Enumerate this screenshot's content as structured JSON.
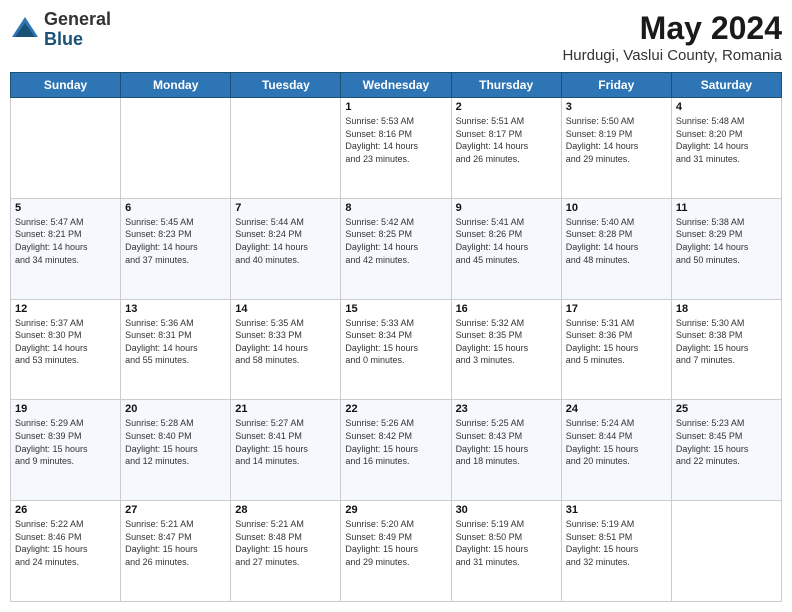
{
  "logo": {
    "general": "General",
    "blue": "Blue"
  },
  "title": "May 2024",
  "subtitle": "Hurdugi, Vaslui County, Romania",
  "weekdays": [
    "Sunday",
    "Monday",
    "Tuesday",
    "Wednesday",
    "Thursday",
    "Friday",
    "Saturday"
  ],
  "weeks": [
    [
      {
        "day": "",
        "info": ""
      },
      {
        "day": "",
        "info": ""
      },
      {
        "day": "",
        "info": ""
      },
      {
        "day": "1",
        "info": "Sunrise: 5:53 AM\nSunset: 8:16 PM\nDaylight: 14 hours\nand 23 minutes."
      },
      {
        "day": "2",
        "info": "Sunrise: 5:51 AM\nSunset: 8:17 PM\nDaylight: 14 hours\nand 26 minutes."
      },
      {
        "day": "3",
        "info": "Sunrise: 5:50 AM\nSunset: 8:19 PM\nDaylight: 14 hours\nand 29 minutes."
      },
      {
        "day": "4",
        "info": "Sunrise: 5:48 AM\nSunset: 8:20 PM\nDaylight: 14 hours\nand 31 minutes."
      }
    ],
    [
      {
        "day": "5",
        "info": "Sunrise: 5:47 AM\nSunset: 8:21 PM\nDaylight: 14 hours\nand 34 minutes."
      },
      {
        "day": "6",
        "info": "Sunrise: 5:45 AM\nSunset: 8:23 PM\nDaylight: 14 hours\nand 37 minutes."
      },
      {
        "day": "7",
        "info": "Sunrise: 5:44 AM\nSunset: 8:24 PM\nDaylight: 14 hours\nand 40 minutes."
      },
      {
        "day": "8",
        "info": "Sunrise: 5:42 AM\nSunset: 8:25 PM\nDaylight: 14 hours\nand 42 minutes."
      },
      {
        "day": "9",
        "info": "Sunrise: 5:41 AM\nSunset: 8:26 PM\nDaylight: 14 hours\nand 45 minutes."
      },
      {
        "day": "10",
        "info": "Sunrise: 5:40 AM\nSunset: 8:28 PM\nDaylight: 14 hours\nand 48 minutes."
      },
      {
        "day": "11",
        "info": "Sunrise: 5:38 AM\nSunset: 8:29 PM\nDaylight: 14 hours\nand 50 minutes."
      }
    ],
    [
      {
        "day": "12",
        "info": "Sunrise: 5:37 AM\nSunset: 8:30 PM\nDaylight: 14 hours\nand 53 minutes."
      },
      {
        "day": "13",
        "info": "Sunrise: 5:36 AM\nSunset: 8:31 PM\nDaylight: 14 hours\nand 55 minutes."
      },
      {
        "day": "14",
        "info": "Sunrise: 5:35 AM\nSunset: 8:33 PM\nDaylight: 14 hours\nand 58 minutes."
      },
      {
        "day": "15",
        "info": "Sunrise: 5:33 AM\nSunset: 8:34 PM\nDaylight: 15 hours\nand 0 minutes."
      },
      {
        "day": "16",
        "info": "Sunrise: 5:32 AM\nSunset: 8:35 PM\nDaylight: 15 hours\nand 3 minutes."
      },
      {
        "day": "17",
        "info": "Sunrise: 5:31 AM\nSunset: 8:36 PM\nDaylight: 15 hours\nand 5 minutes."
      },
      {
        "day": "18",
        "info": "Sunrise: 5:30 AM\nSunset: 8:38 PM\nDaylight: 15 hours\nand 7 minutes."
      }
    ],
    [
      {
        "day": "19",
        "info": "Sunrise: 5:29 AM\nSunset: 8:39 PM\nDaylight: 15 hours\nand 9 minutes."
      },
      {
        "day": "20",
        "info": "Sunrise: 5:28 AM\nSunset: 8:40 PM\nDaylight: 15 hours\nand 12 minutes."
      },
      {
        "day": "21",
        "info": "Sunrise: 5:27 AM\nSunset: 8:41 PM\nDaylight: 15 hours\nand 14 minutes."
      },
      {
        "day": "22",
        "info": "Sunrise: 5:26 AM\nSunset: 8:42 PM\nDaylight: 15 hours\nand 16 minutes."
      },
      {
        "day": "23",
        "info": "Sunrise: 5:25 AM\nSunset: 8:43 PM\nDaylight: 15 hours\nand 18 minutes."
      },
      {
        "day": "24",
        "info": "Sunrise: 5:24 AM\nSunset: 8:44 PM\nDaylight: 15 hours\nand 20 minutes."
      },
      {
        "day": "25",
        "info": "Sunrise: 5:23 AM\nSunset: 8:45 PM\nDaylight: 15 hours\nand 22 minutes."
      }
    ],
    [
      {
        "day": "26",
        "info": "Sunrise: 5:22 AM\nSunset: 8:46 PM\nDaylight: 15 hours\nand 24 minutes."
      },
      {
        "day": "27",
        "info": "Sunrise: 5:21 AM\nSunset: 8:47 PM\nDaylight: 15 hours\nand 26 minutes."
      },
      {
        "day": "28",
        "info": "Sunrise: 5:21 AM\nSunset: 8:48 PM\nDaylight: 15 hours\nand 27 minutes."
      },
      {
        "day": "29",
        "info": "Sunrise: 5:20 AM\nSunset: 8:49 PM\nDaylight: 15 hours\nand 29 minutes."
      },
      {
        "day": "30",
        "info": "Sunrise: 5:19 AM\nSunset: 8:50 PM\nDaylight: 15 hours\nand 31 minutes."
      },
      {
        "day": "31",
        "info": "Sunrise: 5:19 AM\nSunset: 8:51 PM\nDaylight: 15 hours\nand 32 minutes."
      },
      {
        "day": "",
        "info": ""
      }
    ]
  ]
}
